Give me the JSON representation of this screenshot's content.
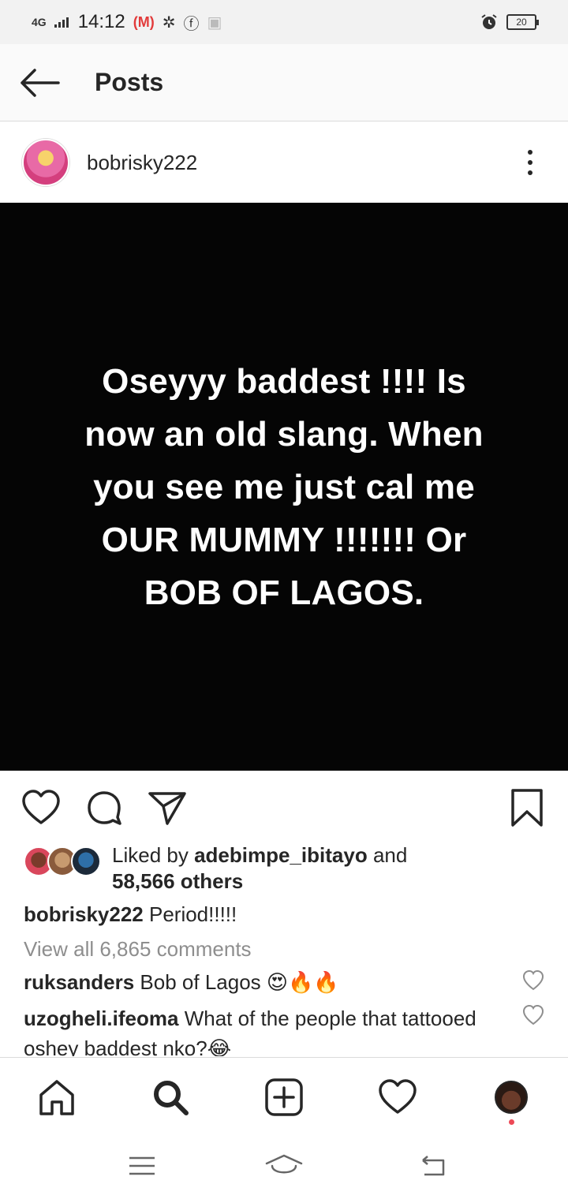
{
  "status_bar": {
    "network": "4G",
    "time": "14:12",
    "battery": "20",
    "icons": [
      "mail-icon",
      "gear-icon",
      "facebook-icon",
      "image-icon",
      "alarm-icon",
      "battery-icon"
    ]
  },
  "header": {
    "title": "Posts"
  },
  "post": {
    "username": "bobrisky222",
    "image_text_lines": [
      "Oseyyy baddest !!!! Is",
      "now an old slang. When",
      "you see me just cal me",
      "OUR MUMMY !!!!!!! Or",
      "BOB OF LAGOS."
    ],
    "liked_by_prefix": "Liked by",
    "liked_by_user": "adebimpe_ibitayo",
    "liked_by_and": "and",
    "liked_others": "58,566 others",
    "caption_user": "bobrisky222",
    "caption_text": "Period!!!!!",
    "view_all": "View all 6,865 comments",
    "comments": [
      {
        "user": "ruksanders",
        "text": "Bob of Lagos 😍🔥🔥"
      },
      {
        "user": "uzogheli.ifeoma",
        "text": "What of the people that tattooed oshey baddest nko?😂"
      }
    ]
  },
  "colors": {
    "text": "#262626",
    "muted": "#8e8e8e",
    "image_bg": "#050505",
    "notification_dot": "#ed4956"
  }
}
